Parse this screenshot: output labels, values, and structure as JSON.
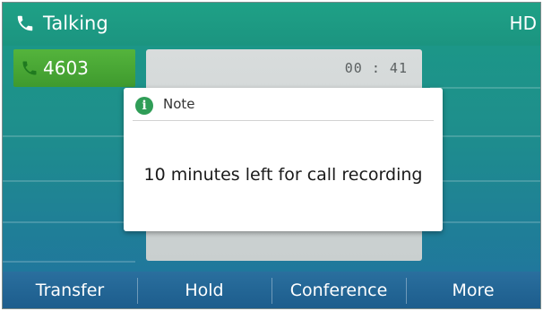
{
  "status_bar": {
    "title": "Talking",
    "quality": "HD",
    "icon": "phone-handset-icon"
  },
  "line_key": {
    "label": "4603",
    "icon": "phone-handset-icon",
    "color": "#4aa835"
  },
  "call_panel": {
    "timer": "00 : 41"
  },
  "dialog": {
    "title": "Note",
    "icon": "info-icon",
    "message": "10 minutes left for call recording"
  },
  "softkeys": [
    {
      "label": "Transfer"
    },
    {
      "label": "Hold"
    },
    {
      "label": "Conference"
    },
    {
      "label": "More"
    }
  ],
  "colors": {
    "status_bg": "#1fa186",
    "softkey_bg": "#2a6f9e",
    "accent_green": "#2f9d57"
  }
}
